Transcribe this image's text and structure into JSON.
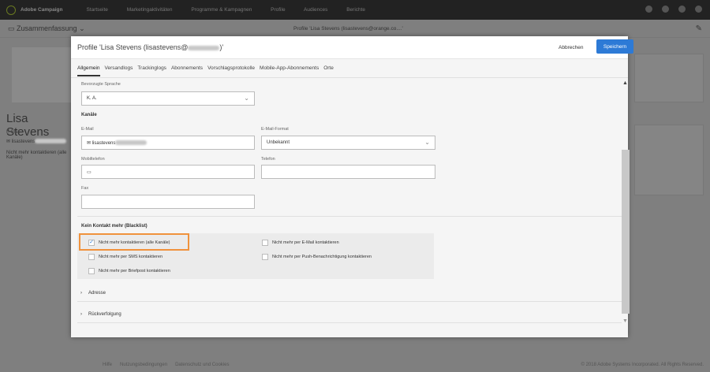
{
  "topbar": {
    "brand": "Adobe Campaign",
    "nav": [
      "Startseite",
      "Marketingaktivitäten",
      "Programme & Kampagnen",
      "Profile",
      "Audiences",
      "Berichte"
    ]
  },
  "subheader": {
    "summary": "Zusammenfassung",
    "profile_title": "Profile 'Lisa Stevens (lisastevens@orange.co....'"
  },
  "left": {
    "name": "Lisa Stevens",
    "email_label": "E-Mail",
    "email_value": "lisastevens",
    "blacklist": "Nicht mehr kontaktieren (alle Kanäle)"
  },
  "footer": {
    "links": [
      "Hilfe",
      "Nutzungsbedingungen",
      "Datenschutz und Cookies"
    ],
    "copyright": "© 2018 Adobe Systems Incorporated. All Rights Reserved."
  },
  "modal": {
    "title_prefix": "Profile 'Lisa Stevens (lisastevens@",
    "title_suffix": ")'",
    "cancel": "Abbrechen",
    "save": "Speichern",
    "accent": "#2d7ad6",
    "tabs": [
      "Allgemein",
      "Versandlogs",
      "Trackinglogs",
      "Abonnements",
      "Vorschlagsprotokolle",
      "Mobile-App-Abonnements",
      "Orte"
    ],
    "language_label": "Bevorzugte Sprache",
    "language_value": "K. A.",
    "channels": "Kanäle",
    "email_label": "E-Mail",
    "email_value": "lisastevens",
    "format_label": "E-Mail-Format",
    "format_value": "Unbekannt",
    "mobile_label": "Mobiltelefon",
    "phone_label": "Telefon",
    "fax_label": "Fax",
    "blacklist_title": "Kein Kontakt mehr (Blacklist)",
    "checkboxes": [
      {
        "label": "Nicht mehr kontaktieren (alle Kanäle)",
        "checked": true
      },
      {
        "label": "Nicht mehr per E-Mail kontaktieren",
        "checked": false
      },
      {
        "label": "Nicht mehr per SMS kontaktieren",
        "checked": false
      },
      {
        "label": "Nicht mehr per Push-Benachrichtigung kontaktieren",
        "checked": false
      },
      {
        "label": "Nicht mehr per Briefpost kontaktieren",
        "checked": false
      }
    ],
    "sections": [
      "Adresse",
      "Rückverfolgung"
    ]
  }
}
